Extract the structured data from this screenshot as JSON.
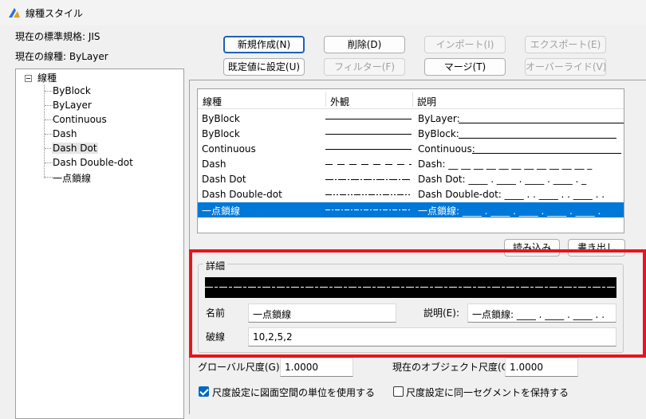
{
  "window": {
    "title": "線種スタイル"
  },
  "info": {
    "standard_label": "現在の標準規格: JIS",
    "current_linetype_label": "現在の線種: ByLayer"
  },
  "tree": {
    "root": "線種",
    "items": [
      "ByBlock",
      "ByLayer",
      "Continuous",
      "Dash",
      "Dash Dot",
      "Dash Double-dot",
      "一点鎖線"
    ],
    "selected": "Dash Dot"
  },
  "buttons": {
    "new": "新規作成(N)",
    "delete": "削除(D)",
    "import": "インポート(I)",
    "export": "エクスポート(E)",
    "set_default": "既定値に設定(U)",
    "filter": "フィルター(F)",
    "merge": "マージ(T)",
    "override": "オーバーライド(V)",
    "load": "読み込み",
    "save": "書き出し"
  },
  "list": {
    "columns": [
      "線種",
      "外観",
      "説明"
    ],
    "rows": [
      {
        "name": "ByBlock",
        "pattern": "solid",
        "description": "ByLayer:"
      },
      {
        "name": "ByBlock",
        "pattern": "solid",
        "description": "ByBlock:"
      },
      {
        "name": "Continuous",
        "pattern": "solid",
        "description": "Continuous:"
      },
      {
        "name": "Dash",
        "pattern": "dash",
        "description": "Dash: __ __ __ __ __ __ __ __ __ __ __ _"
      },
      {
        "name": "Dash Dot",
        "pattern": "dashdot",
        "description": "Dash Dot: ____ . ____ . ____ . ____ . _"
      },
      {
        "name": "Dash Double-dot",
        "pattern": "dashdoubledot",
        "description": "Dash Double-dot: ____ . . ____ . . ____ . ."
      },
      {
        "name": "一点鎖線",
        "pattern": "chain",
        "description": "一点鎖線: ____ . ____ . ____ . ____ . ____ ."
      }
    ],
    "selected_index": 6
  },
  "details": {
    "group_label": "詳細",
    "name_label": "名前",
    "name_value": "一点鎖線",
    "desc_label": "説明(E):",
    "desc_value": "一点鎖線: ____ . ____ . ____ . .",
    "dash_label": "破線",
    "dash_value": "10,2,5,2"
  },
  "scale": {
    "global_label": "グローバル尺度(G):",
    "global_value": "1.0000",
    "object_label": "現在のオブジェクト尺度(O):",
    "object_value": "1.0000"
  },
  "options": {
    "use_paper_units_label": "尺度設定に図面空間の単位を使用する",
    "use_paper_units_checked": true,
    "keep_segment_label": "尺度設定に同一セグメントを保持する",
    "keep_segment_checked": false
  },
  "colors": {
    "accent": "#0078d7",
    "highlight_frame": "#e8141b"
  }
}
